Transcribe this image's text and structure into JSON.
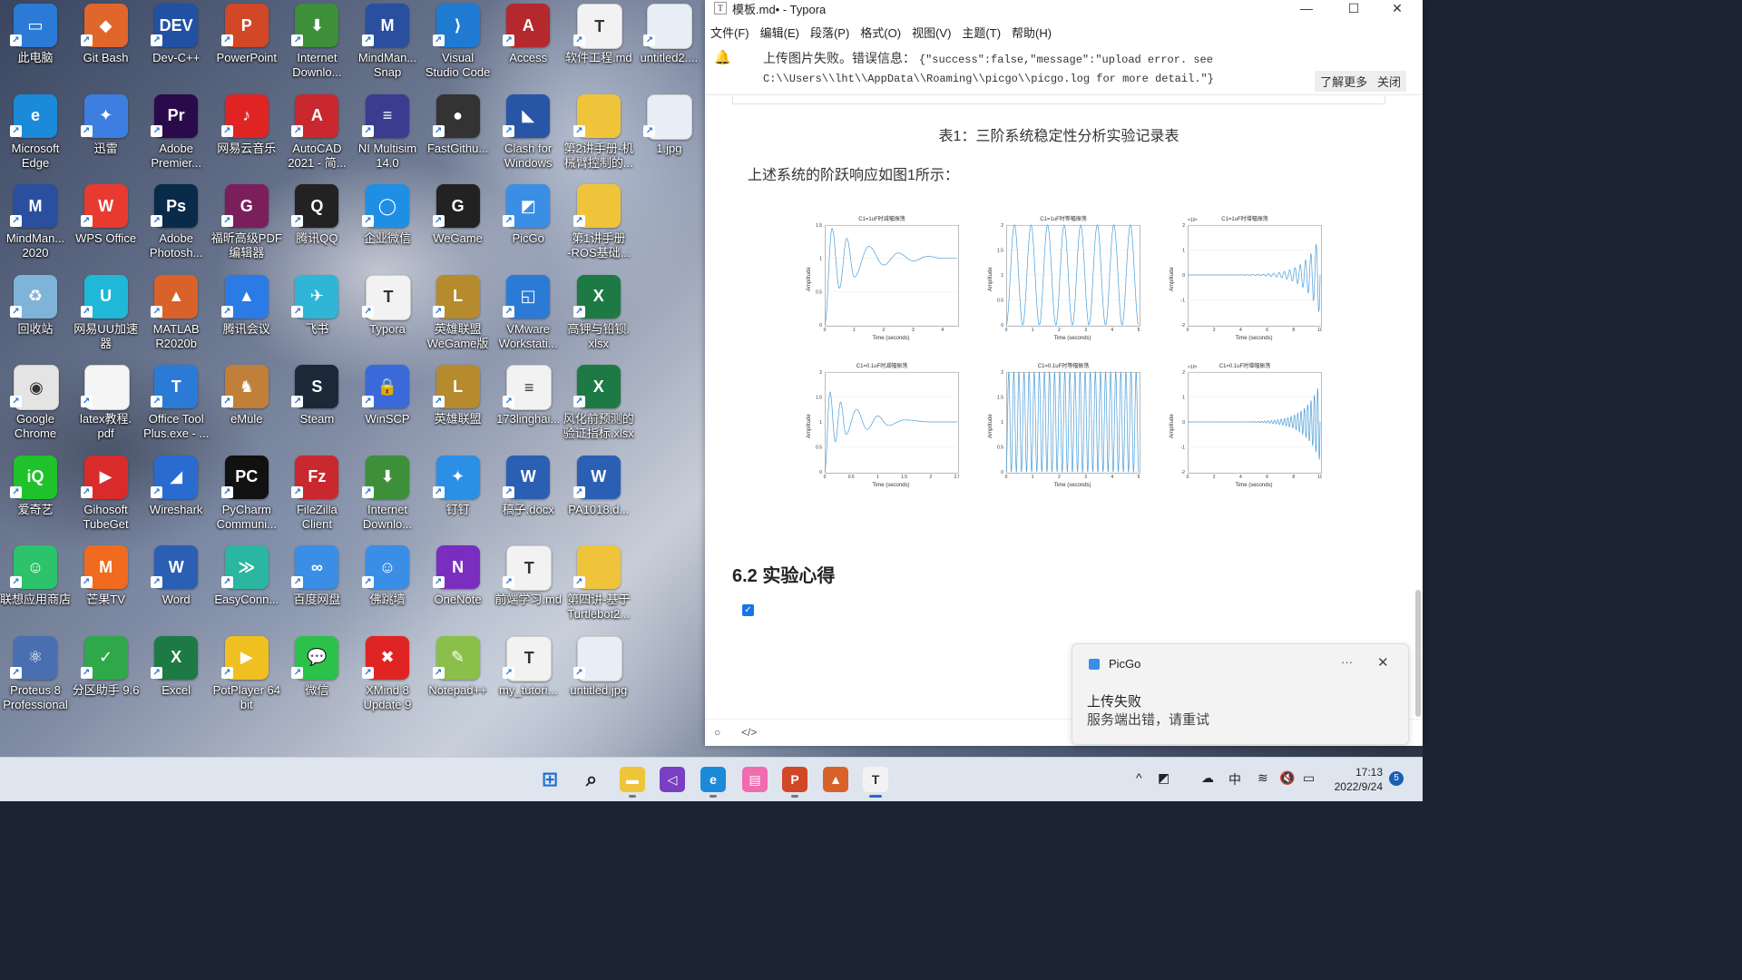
{
  "desktop": {
    "icons": [
      {
        "label": "此电脑",
        "color": "#2b7bd6",
        "glyph": "▭",
        "col": 0,
        "row": 0
      },
      {
        "label": "Git Bash",
        "color": "#e0662b",
        "glyph": "◆",
        "col": 1,
        "row": 0
      },
      {
        "label": "Dev-C++",
        "color": "#2251a3",
        "glyph": "DEV",
        "col": 2,
        "row": 0
      },
      {
        "label": "PowerPoint",
        "color": "#d24726",
        "glyph": "P",
        "col": 3,
        "row": 0
      },
      {
        "label": "Internet\nDownlo...",
        "color": "#3d8f3a",
        "glyph": "⬇",
        "col": 4,
        "row": 0
      },
      {
        "label": "MindMan...\nSnap",
        "color": "#2a4f9e",
        "glyph": "M",
        "col": 5,
        "row": 0
      },
      {
        "label": "Visual\nStudio Code",
        "color": "#1f7ad2",
        "glyph": "⟩",
        "col": 6,
        "row": 0
      },
      {
        "label": "Access",
        "color": "#b5282e",
        "glyph": "A",
        "col": 7,
        "row": 0
      },
      {
        "label": "软件工程.md",
        "color": "#f2f2f2",
        "glyph": "T",
        "col": 8,
        "row": 0
      },
      {
        "label": "untitled2....",
        "color": "#e8eef5",
        "glyph": "",
        "col": 9,
        "row": 0
      },
      {
        "label": "Microsoft\nEdge",
        "color": "#1b8ad8",
        "glyph": "e",
        "col": 0,
        "row": 1
      },
      {
        "label": "迅雷",
        "color": "#3d7fe0",
        "glyph": "✦",
        "col": 1,
        "row": 1
      },
      {
        "label": "Adobe\nPremier...",
        "color": "#2a0a4a",
        "glyph": "Pr",
        "col": 2,
        "row": 1
      },
      {
        "label": "网易云音乐",
        "color": "#e02424",
        "glyph": "♪",
        "col": 3,
        "row": 1
      },
      {
        "label": "AutoCAD\n2021 - 简...",
        "color": "#c8282e",
        "glyph": "A",
        "col": 4,
        "row": 1
      },
      {
        "label": "NI Multisim\n14.0",
        "color": "#3b3b8f",
        "glyph": "≡",
        "col": 5,
        "row": 1
      },
      {
        "label": "FastGithu...",
        "color": "#333333",
        "glyph": "●",
        "col": 6,
        "row": 1
      },
      {
        "label": "Clash for\nWindows",
        "color": "#2855a6",
        "glyph": "◣",
        "col": 7,
        "row": 1
      },
      {
        "label": "第2讲手册-机\n械臂控制的...",
        "color": "#f0c43a",
        "glyph": "",
        "col": 8,
        "row": 1
      },
      {
        "label": "1.jpg",
        "color": "#e8eef5",
        "glyph": "",
        "col": 9,
        "row": 1
      },
      {
        "label": "MindMan...\n2020",
        "color": "#2a4f9e",
        "glyph": "M",
        "col": 0,
        "row": 2
      },
      {
        "label": "WPS Office",
        "color": "#e83a2f",
        "glyph": "W",
        "col": 1,
        "row": 2
      },
      {
        "label": "Adobe\nPhotosh...",
        "color": "#0a2a4a",
        "glyph": "Ps",
        "col": 2,
        "row": 2
      },
      {
        "label": "福昕高级PDF\n编辑器",
        "color": "#7a1f5c",
        "glyph": "G",
        "col": 3,
        "row": 2
      },
      {
        "label": "腾讯QQ",
        "color": "#222222",
        "glyph": "Q",
        "col": 4,
        "row": 2
      },
      {
        "label": "企业微信",
        "color": "#1f8fe6",
        "glyph": "◯",
        "col": 5,
        "row": 2
      },
      {
        "label": "WeGame",
        "color": "#222222",
        "glyph": "G",
        "col": 6,
        "row": 2
      },
      {
        "label": "PicGo",
        "color": "#3a8ee6",
        "glyph": "◩",
        "col": 7,
        "row": 2
      },
      {
        "label": "第1讲手册\n-ROS基础...",
        "color": "#f0c43a",
        "glyph": "",
        "col": 8,
        "row": 2
      },
      {
        "label": "回收站",
        "color": "#7fb3d9",
        "glyph": "♻",
        "col": 0,
        "row": 3
      },
      {
        "label": "网易UU加速\n器",
        "color": "#1fb8d9",
        "glyph": "U",
        "col": 1,
        "row": 3
      },
      {
        "label": "MATLAB\nR2020b",
        "color": "#d9622b",
        "glyph": "▲",
        "col": 2,
        "row": 3
      },
      {
        "label": "腾讯会议",
        "color": "#2b7be6",
        "glyph": "▲",
        "col": 3,
        "row": 3
      },
      {
        "label": "飞书",
        "color": "#2fb5d6",
        "glyph": "✈",
        "col": 4,
        "row": 3
      },
      {
        "label": "Typora",
        "color": "#f2f2f2",
        "glyph": "T",
        "col": 5,
        "row": 3
      },
      {
        "label": "英雄联盟\nWeGame版",
        "color": "#b58b2e",
        "glyph": "L",
        "col": 6,
        "row": 3
      },
      {
        "label": "VMware\nWorkstati...",
        "color": "#2b7bd6",
        "glyph": "◱",
        "col": 7,
        "row": 3
      },
      {
        "label": "高钾与铅钡.\nxlsx",
        "color": "#1e7a44",
        "glyph": "X",
        "col": 8,
        "row": 3
      },
      {
        "label": "Google\nChrome",
        "color": "#e4e4e4",
        "glyph": "◉",
        "col": 0,
        "row": 4
      },
      {
        "label": "latex教程.\npdf",
        "color": "#f5f5f5",
        "glyph": "",
        "col": 1,
        "row": 4
      },
      {
        "label": "Office Tool\nPlus.exe - ...",
        "color": "#2b7bd6",
        "glyph": "T",
        "col": 2,
        "row": 4
      },
      {
        "label": "eMule",
        "color": "#c0803a",
        "glyph": "♞",
        "col": 3,
        "row": 4
      },
      {
        "label": "Steam",
        "color": "#1b2838",
        "glyph": "S",
        "col": 4,
        "row": 4
      },
      {
        "label": "WinSCP",
        "color": "#3a6ad9",
        "glyph": "🔒",
        "col": 5,
        "row": 4
      },
      {
        "label": "英雄联盟",
        "color": "#b58b2e",
        "glyph": "L",
        "col": 6,
        "row": 4
      },
      {
        "label": "173linghai...",
        "color": "#f2f2f2",
        "glyph": "≡",
        "col": 7,
        "row": 4
      },
      {
        "label": "风化前预测的\n验证指标.xlsx",
        "color": "#1e7a44",
        "glyph": "X",
        "col": 8,
        "row": 4
      },
      {
        "label": "爱奇艺",
        "color": "#1fc22a",
        "glyph": "iQ",
        "col": 0,
        "row": 5
      },
      {
        "label": "Gihosoft\nTubeGet",
        "color": "#d92b2b",
        "glyph": "▶",
        "col": 1,
        "row": 5
      },
      {
        "label": "Wireshark",
        "color": "#2a6bd0",
        "glyph": "◢",
        "col": 2,
        "row": 5
      },
      {
        "label": "PyCharm\nCommuni...",
        "color": "#111111",
        "glyph": "PC",
        "col": 3,
        "row": 5
      },
      {
        "label": "FileZilla\nClient",
        "color": "#c8282e",
        "glyph": "Fz",
        "col": 4,
        "row": 5
      },
      {
        "label": "Internet\nDownlo...",
        "color": "#3d8f3a",
        "glyph": "⬇",
        "col": 5,
        "row": 5
      },
      {
        "label": "钉钉",
        "color": "#2b8fe6",
        "glyph": "✦",
        "col": 6,
        "row": 5
      },
      {
        "label": "稿子.docx",
        "color": "#2b5fb4",
        "glyph": "W",
        "col": 7,
        "row": 5
      },
      {
        "label": "PA1018.d...",
        "color": "#2b5fb4",
        "glyph": "W",
        "col": 8,
        "row": 5
      },
      {
        "label": "联想应用商店",
        "color": "#2cc36b",
        "glyph": "☺",
        "col": 0,
        "row": 6
      },
      {
        "label": "芒果TV",
        "color": "#f06b1e",
        "glyph": "M",
        "col": 1,
        "row": 6
      },
      {
        "label": "Word",
        "color": "#2b5fb4",
        "glyph": "W",
        "col": 2,
        "row": 6
      },
      {
        "label": "EasyConn...",
        "color": "#2ab6a0",
        "glyph": "≫",
        "col": 3,
        "row": 6
      },
      {
        "label": "百度网盘",
        "color": "#3a8ee6",
        "glyph": "∞",
        "col": 4,
        "row": 6
      },
      {
        "label": "佛跳墙",
        "color": "#3a8ee6",
        "glyph": "☺",
        "col": 5,
        "row": 6
      },
      {
        "label": "OneNote",
        "color": "#7a2ec0",
        "glyph": "N",
        "col": 6,
        "row": 6
      },
      {
        "label": "前端学习.md",
        "color": "#f2f2f2",
        "glyph": "T",
        "col": 7,
        "row": 6
      },
      {
        "label": "第四讲-基于\nTurtlebot2...",
        "color": "#f0c43a",
        "glyph": "",
        "col": 8,
        "row": 6
      },
      {
        "label": "Proteus 8\nProfessional",
        "color": "#4a6fb0",
        "glyph": "⚛",
        "col": 0,
        "row": 7
      },
      {
        "label": "分区助手 9.6",
        "color": "#2fa84a",
        "glyph": "✓",
        "col": 1,
        "row": 7
      },
      {
        "label": "Excel",
        "color": "#1e7a44",
        "glyph": "X",
        "col": 2,
        "row": 7
      },
      {
        "label": "PotPlayer 64\nbit",
        "color": "#f0c020",
        "glyph": "▶",
        "col": 3,
        "row": 7
      },
      {
        "label": "微信",
        "color": "#2cc14a",
        "glyph": "💬",
        "col": 4,
        "row": 7
      },
      {
        "label": "XMind 8\nUpdate 9",
        "color": "#e02424",
        "glyph": "✖",
        "col": 5,
        "row": 7
      },
      {
        "label": "Notepad++",
        "color": "#8ac04a",
        "glyph": "✎",
        "col": 6,
        "row": 7
      },
      {
        "label": "my_tutori...",
        "color": "#f2f2f2",
        "glyph": "T",
        "col": 7,
        "row": 7
      },
      {
        "label": "untitled.jpg",
        "color": "#e8eef5",
        "glyph": "",
        "col": 8,
        "row": 7
      }
    ]
  },
  "window": {
    "title": "模板.md• - Typora",
    "menu": [
      "文件(F)",
      "编辑(E)",
      "段落(P)",
      "格式(O)",
      "视图(V)",
      "主题(T)",
      "帮助(H)"
    ],
    "error": {
      "prefix": "上传图片失败。错误信息：",
      "json_line1": "{\"success\":false,\"message\":\"upload error. see",
      "json_line2": "C:\\\\Users\\\\lht\\\\AppData\\\\Roaming\\\\picgo\\\\picgo.log for more detail.\"}",
      "learn_more": "了解更多",
      "close": "关闭"
    },
    "caption": "表1：三阶系统稳定性分析实验记录表",
    "paragraph": "上述系统的阶跃响应如图1所示：",
    "heading": "6.2 实验心得",
    "status_left": "○",
    "status_code": "</>"
  },
  "chart_data": [
    {
      "type": "line",
      "title": "C1=1uF时减幅振荡",
      "xlabel": "Time (seconds)",
      "ylabel": "Amplitude",
      "xticks": [
        "0",
        "1",
        "2",
        "3",
        "4"
      ],
      "yticks": [
        "0",
        "0.5",
        "1",
        "1.5"
      ],
      "behavior": "damped",
      "xlim": [
        0,
        4.5
      ],
      "ylim": [
        0,
        1.5
      ],
      "x": [
        0,
        0.25,
        0.5,
        0.75,
        1,
        1.5,
        2,
        2.5,
        3,
        3.5,
        4,
        4.5
      ],
      "values": [
        0,
        1.45,
        0.55,
        1.3,
        0.72,
        1.18,
        0.9,
        1.08,
        0.96,
        1.03,
        1,
        1
      ]
    },
    {
      "type": "line",
      "title": "C1=1uF时等幅振荡",
      "xlabel": "Time (seconds)",
      "ylabel": "Amplitude",
      "xticks": [
        "0",
        "1",
        "2",
        "3",
        "4",
        "5"
      ],
      "yticks": [
        "0",
        "0.5",
        "1",
        "1.5",
        "2"
      ],
      "behavior": "constant",
      "xlim": [
        0,
        5
      ],
      "ylim": [
        0,
        2
      ],
      "amplitude": 1,
      "offset": 1,
      "cycles": 8
    },
    {
      "type": "line",
      "title": "C1=1uF时增幅振荡",
      "xlabel": "Time (seconds)",
      "ylabel": "Amplitude",
      "xticks": [
        "0",
        "2",
        "4",
        "6",
        "8",
        "10"
      ],
      "yticks": [
        "-2",
        "-1",
        "0",
        "1",
        "2"
      ],
      "yexponent": "×10⁵",
      "behavior": "growing",
      "xlim": [
        0,
        10
      ],
      "ylim": [
        -2,
        2
      ]
    },
    {
      "type": "line",
      "title": "C1=0.1uF时减幅振荡",
      "xlabel": "Time (seconds)",
      "ylabel": "Amplitude",
      "xticks": [
        "0",
        "0.5",
        "1",
        "1.5",
        "2",
        "2.5"
      ],
      "yticks": [
        "0",
        "0.5",
        "1",
        "1.5",
        "2"
      ],
      "behavior": "damped",
      "xlim": [
        0,
        2.5
      ],
      "ylim": [
        0,
        2
      ],
      "x": [
        0,
        0.1,
        0.2,
        0.3,
        0.4,
        0.6,
        0.8,
        1.0,
        1.2,
        1.5,
        2,
        2.5
      ],
      "values": [
        0,
        1.6,
        0.6,
        1.4,
        0.75,
        1.25,
        0.85,
        1.12,
        0.93,
        1.04,
        1,
        1
      ]
    },
    {
      "type": "line",
      "title": "C1=0.1uF时等幅振荡",
      "xlabel": "Time (seconds)",
      "ylabel": "Amplitude",
      "xticks": [
        "0",
        "1",
        "2",
        "3",
        "4",
        "5"
      ],
      "yticks": [
        "0",
        "0.5",
        "1",
        "1.5",
        "2"
      ],
      "behavior": "constant",
      "xlim": [
        0,
        5
      ],
      "ylim": [
        0,
        2
      ],
      "amplitude": 1,
      "offset": 1,
      "cycles": 26
    },
    {
      "type": "line",
      "title": "C1=0.1uF时增幅振荡",
      "xlabel": "Time (seconds)",
      "ylabel": "Amplitude",
      "xticks": [
        "0",
        "2",
        "4",
        "6",
        "8",
        "10"
      ],
      "yticks": [
        "-2",
        "-1",
        "0",
        "1",
        "2"
      ],
      "yexponent": "×10⁵",
      "behavior": "growing",
      "xlim": [
        0,
        10
      ],
      "ylim": [
        -2,
        2
      ]
    }
  ],
  "notification": {
    "app": "PicGo",
    "more": "···",
    "close": "✕",
    "title": "上传失败",
    "body": "服务端出错，请重试"
  },
  "taskbar": {
    "apps": [
      {
        "name": "start",
        "glyph": "⊞",
        "color": "#1f6fd0"
      },
      {
        "name": "search",
        "glyph": "⌕",
        "color": "#222222"
      },
      {
        "name": "file-explorer",
        "glyph": "▬",
        "color": "#f0c43a"
      },
      {
        "name": "visual-studio",
        "glyph": "◁",
        "color": "#7a3fc0"
      },
      {
        "name": "edge",
        "glyph": "e",
        "color": "#1b8ad8"
      },
      {
        "name": "bilibili",
        "glyph": "▤",
        "color": "#f06bb0"
      },
      {
        "name": "powerpoint",
        "glyph": "P",
        "color": "#d24726"
      },
      {
        "name": "matlab",
        "glyph": "▲",
        "color": "#d9622b"
      },
      {
        "name": "typora",
        "glyph": "T",
        "color": "#f2f2f2"
      }
    ],
    "tray": [
      "^",
      "◩",
      "☁",
      "中",
      "≋",
      "🔇",
      "▭"
    ],
    "time": "17:13",
    "date": "2022/9/24",
    "badge": "5"
  }
}
